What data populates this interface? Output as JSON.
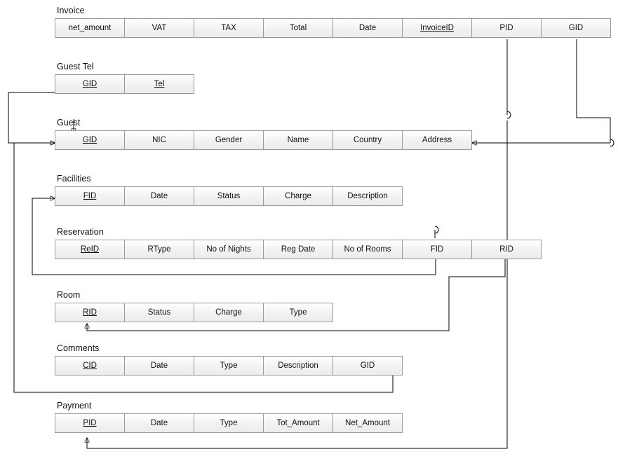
{
  "tables": {
    "invoice": {
      "title": "Invoice",
      "cols": [
        "net_amount",
        "VAT",
        "TAX",
        "Total",
        "Date",
        "InvoiceID",
        "PID",
        "GID"
      ],
      "pk": [
        5
      ]
    },
    "guest_tel": {
      "title": "Guest Tel",
      "cols": [
        "GID",
        "Tel"
      ],
      "pk": [
        0,
        1
      ]
    },
    "guest": {
      "title": "Guest",
      "cols": [
        "GID",
        "NIC",
        "Gender",
        "Name",
        "Country",
        "Address"
      ],
      "pk": [
        0
      ]
    },
    "facilities": {
      "title": "Facilities",
      "cols": [
        "FID",
        "Date",
        "Status",
        "Charge",
        "Description"
      ],
      "pk": [
        0
      ]
    },
    "reservation": {
      "title": "Reservation",
      "cols": [
        "ReID",
        "RType",
        "No of Nights",
        "Reg Date",
        "No of Rooms",
        "FID",
        "RID"
      ],
      "pk": [
        0
      ]
    },
    "room": {
      "title": "Room",
      "cols": [
        "RID",
        "Status",
        "Charge",
        "Type"
      ],
      "pk": [
        0
      ]
    },
    "comments": {
      "title": "Comments",
      "cols": [
        "CID",
        "Date",
        "Type",
        "Description",
        "GID"
      ],
      "pk": [
        0
      ]
    },
    "payment": {
      "title": "Payment",
      "cols": [
        "PID",
        "Date",
        "Type",
        "Tot_Amount",
        "Net_Amount"
      ],
      "pk": [
        0
      ]
    }
  }
}
